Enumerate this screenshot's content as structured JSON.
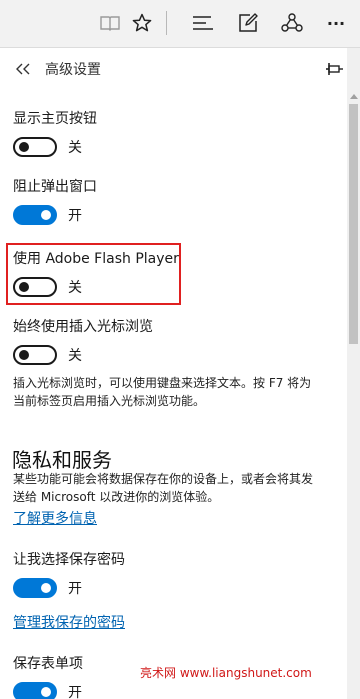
{
  "toolbar": {
    "icons": [
      "reading-view-icon",
      "favorite-star-icon",
      "hub-icon",
      "web-note-icon",
      "share-icon",
      "more-icon"
    ],
    "more_label": "···"
  },
  "panel": {
    "title": "高级设置",
    "back_icon": "«"
  },
  "settings": [
    {
      "label": "显示主页按钮",
      "state": "关",
      "on": false
    },
    {
      "label": "阻止弹出窗口",
      "state": "开",
      "on": true
    },
    {
      "label": "使用 Adobe Flash Player",
      "state": "关",
      "on": false
    },
    {
      "label": "始终使用插入光标浏览",
      "state": "关",
      "on": false
    }
  ],
  "caret_desc_line1": "插入光标浏览时，可以使用键盘来选择文本。按 F7 将为",
  "caret_desc_line2": "当前标签页启用插入光标浏览功能。",
  "privacy": {
    "title": "隐私和服务",
    "desc_line1": "某些功能可能会将数据保存在你的设备上，或者会将其发",
    "desc_line2": "送给 Microsoft 以改进你的浏览体验。",
    "learn_more": "了解更多信息"
  },
  "password": {
    "label": "让我选择保存密码",
    "state": "开",
    "on": true,
    "manage_link": "管理我保存的密码"
  },
  "forms": {
    "label": "保存表单项",
    "state": "开",
    "on": true
  },
  "watermark": "亮术网 www.liangshunet.com",
  "colors": {
    "accent": "#0078d7",
    "link": "#0063b1",
    "highlight": "#e02020",
    "watermark": "#d01818"
  }
}
